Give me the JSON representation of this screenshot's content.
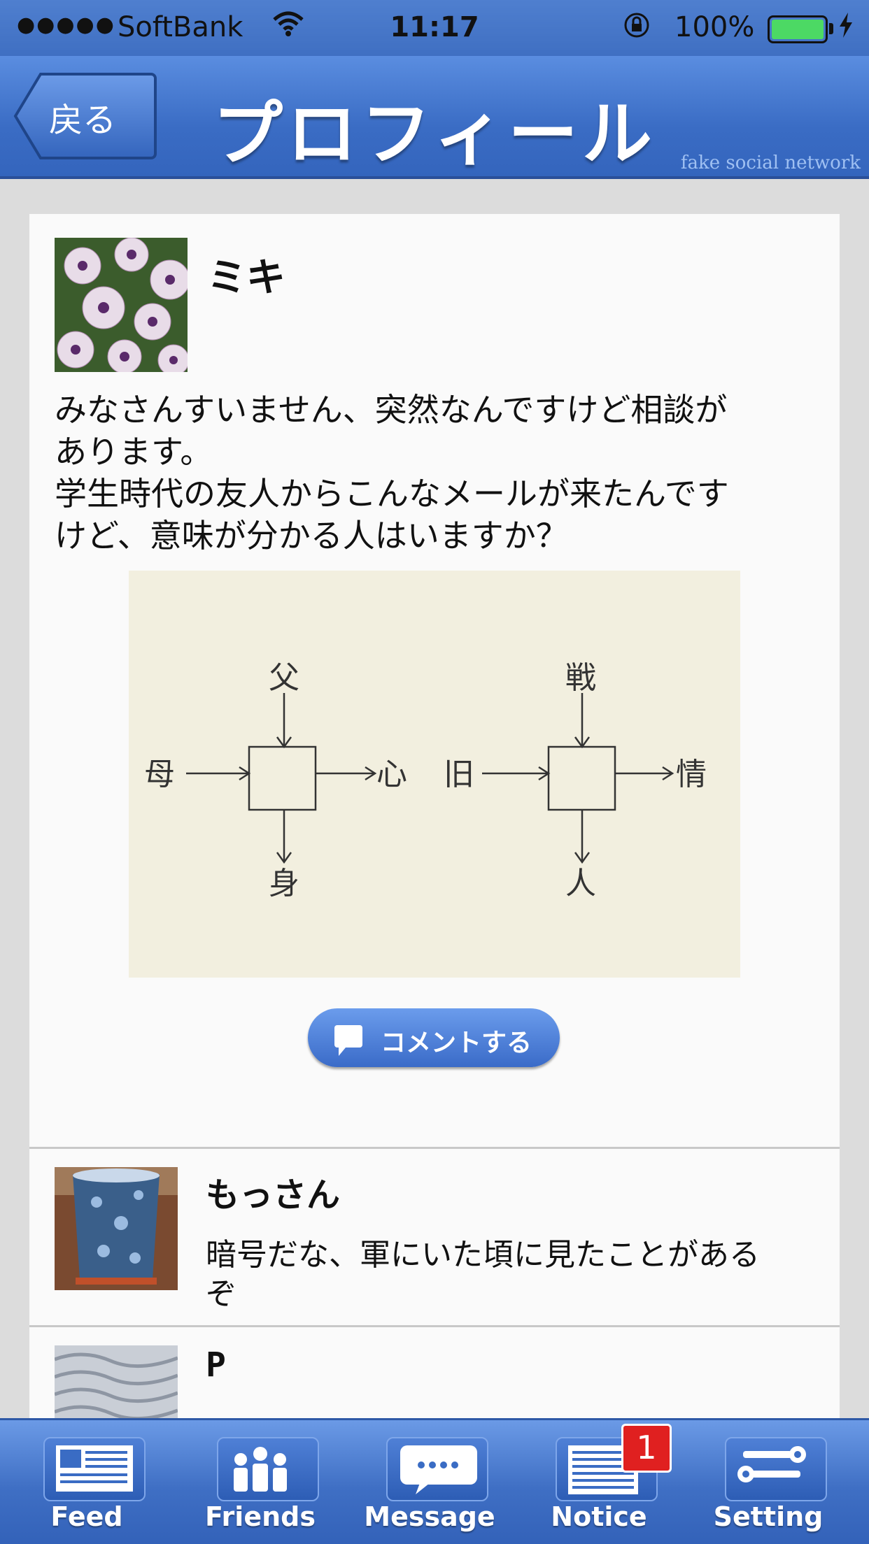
{
  "status_bar": {
    "signal": "●●●●●",
    "carrier": "SoftBank",
    "time": "11:17",
    "battery": "100%",
    "wifi_icon": "wifi-icon",
    "lock_icon": "rotation-lock-icon",
    "charging_icon": "bolt-icon"
  },
  "nav": {
    "back_label": "戻る",
    "title": "プロフィール",
    "brand": "fake social network"
  },
  "post": {
    "author": "ミキ",
    "lines": [
      "みなさんすいません、突然なんですけど相談が",
      "あります。",
      "学生時代の友人からこんなメールが来たんです",
      "けど、意味が分かる人はいますか？"
    ],
    "diagram": {
      "left": {
        "top": "父",
        "left": "母",
        "right": "心",
        "bottom": "身"
      },
      "right": {
        "top": "戦",
        "left": "旧",
        "right": "情",
        "bottom": "人"
      }
    },
    "comment_button": "コメントする"
  },
  "comments": [
    {
      "author": "もっさん",
      "text_lines": [
        "暗号だな、軍にいた頃に見たことがある",
        "ぞ"
      ]
    },
    {
      "author": "P",
      "text_lines": []
    }
  ],
  "tabs": [
    {
      "label": "Feed",
      "icon": "feed-icon"
    },
    {
      "label": "Friends",
      "icon": "friends-icon"
    },
    {
      "label": "Message",
      "icon": "message-icon"
    },
    {
      "label": "Notice",
      "icon": "notice-icon",
      "badge": "1"
    },
    {
      "label": "Setting",
      "icon": "setting-icon"
    }
  ],
  "colors": {
    "nav_blue": "#3a6cc4",
    "badge_red": "#e02020",
    "battery_green": "#4cd964"
  }
}
